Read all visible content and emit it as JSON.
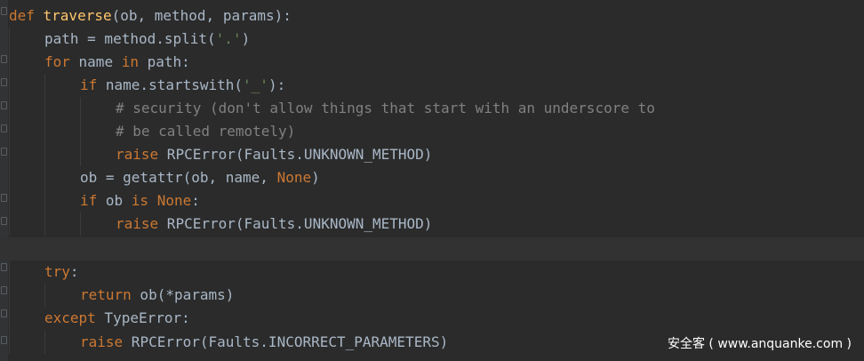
{
  "code": {
    "l1": {
      "kw": "def ",
      "fn": "traverse",
      "rest": "(ob, method, params):"
    },
    "l2": {
      "a": "path = method.split(",
      "str": "'.'",
      "b": ")"
    },
    "l3": {
      "kw1": "for",
      "a": " name ",
      "kw2": "in",
      "b": " path:"
    },
    "l4": {
      "kw": "if",
      "a": " name.startswith(",
      "str": "'_'",
      "b": "):"
    },
    "l5": {
      "comment": "# security (don't allow things that start with an underscore to"
    },
    "l6": {
      "comment": "# be called remotely)"
    },
    "l7": {
      "kw": "raise",
      "a": " RPCError(Faults.UNKNOWN_METHOD)"
    },
    "l8": {
      "a": "ob = getattr(ob, name, ",
      "kw": "None",
      "b": ")"
    },
    "l9": {
      "kw1": "if",
      "a": " ob ",
      "kw2": "is",
      "b": " ",
      "kw3": "None",
      "c": ":"
    },
    "l10": {
      "kw": "raise",
      "a": " RPCError(Faults.UNKNOWN_METHOD)"
    },
    "l12": {
      "kw": "try",
      "a": ":"
    },
    "l13": {
      "kw": "return",
      "a": " ob(*params)"
    },
    "l14": {
      "kw": "except",
      "a": " TypeError:"
    },
    "l15": {
      "kw": "raise",
      "a": " RPCError(Faults.INCORRECT_PARAMETERS)"
    }
  },
  "watermark": "安全客 ( www.anquanke.com )",
  "colors": {
    "background": "#2b2b2b",
    "keyword": "#cc7832",
    "function": "#ffc66d",
    "string": "#6a8759",
    "comment": "#808080",
    "text": "#a9b7c6"
  }
}
